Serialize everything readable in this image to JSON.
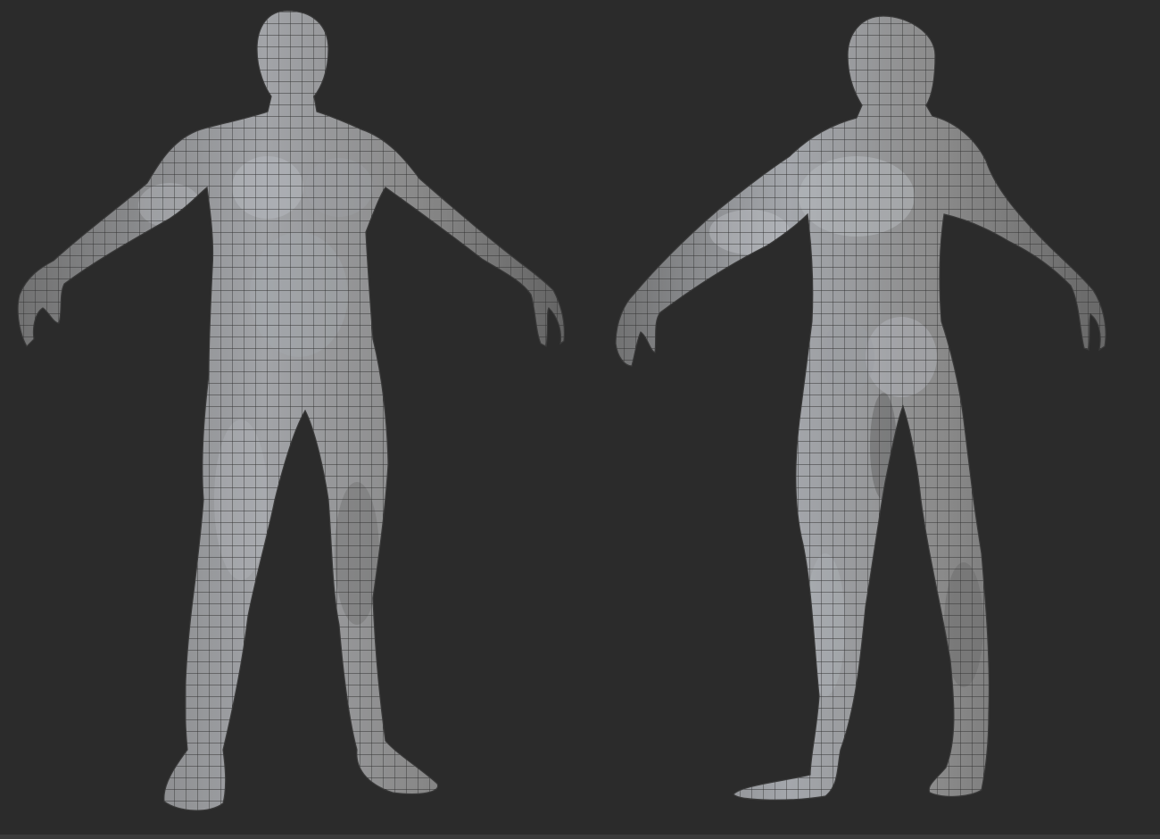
{
  "viewport": {
    "background": "#2b2b2b",
    "bottom_strip": "#3a3a3a"
  },
  "figures": [
    {
      "view": "front",
      "surface": "#8a8a8a",
      "wire": "#3c3c3c",
      "highlight": "#b8bcc2"
    },
    {
      "view": "back",
      "surface": "#8a8a8a",
      "wire": "#3c3c3c",
      "highlight": "#b8bcc2"
    }
  ]
}
